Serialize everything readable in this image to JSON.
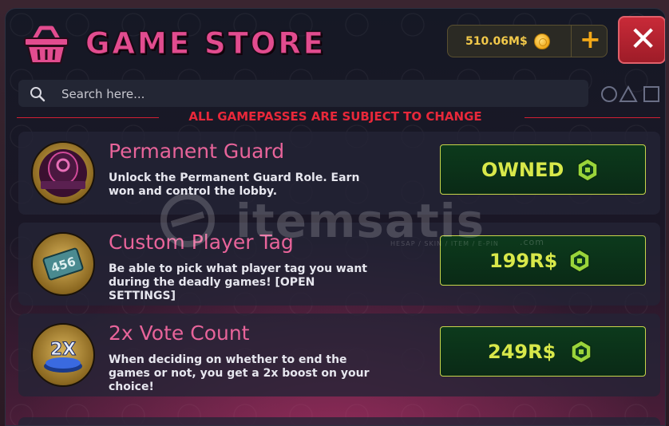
{
  "header": {
    "title": "GAME STORE",
    "icon": "basket-icon",
    "currency": {
      "amount": "510.06M$",
      "coin_icon": "coin-icon",
      "add_icon": "plus-icon"
    },
    "close_icon": "close-icon"
  },
  "search": {
    "placeholder": "Search here..."
  },
  "notice": "ALL GAMEPASSES ARE SUBJECT TO CHANGE",
  "items": [
    {
      "name": "Permanent Guard",
      "description": "Unlock the Permanent Guard Role. Earn won and control the lobby.",
      "price_label": "OWNED",
      "icon": "guard-mask-icon"
    },
    {
      "name": "Custom Player Tag",
      "description": "Be able to pick what player tag you want during the deadly games! [OPEN SETTINGS]",
      "price_label": "199R$",
      "icon": "player-tag-icon"
    },
    {
      "name": "2x Vote Count",
      "description": "When deciding on whether to end the games or not, you get a 2x boost on your choice!",
      "price_label": "249R$",
      "icon": "vote-2x-icon"
    }
  ],
  "watermark": {
    "text": "itemsatis",
    "sub": "HESAP / SKIN / ITEM / E-PIN",
    "suffix": ".com"
  },
  "colors": {
    "title": "#e24c8f",
    "notice": "#e8283a",
    "price_text": "#d8e84a",
    "button_bg": "#0c3a1c",
    "close": "#c82a38",
    "currency_text": "#f2c94a"
  }
}
